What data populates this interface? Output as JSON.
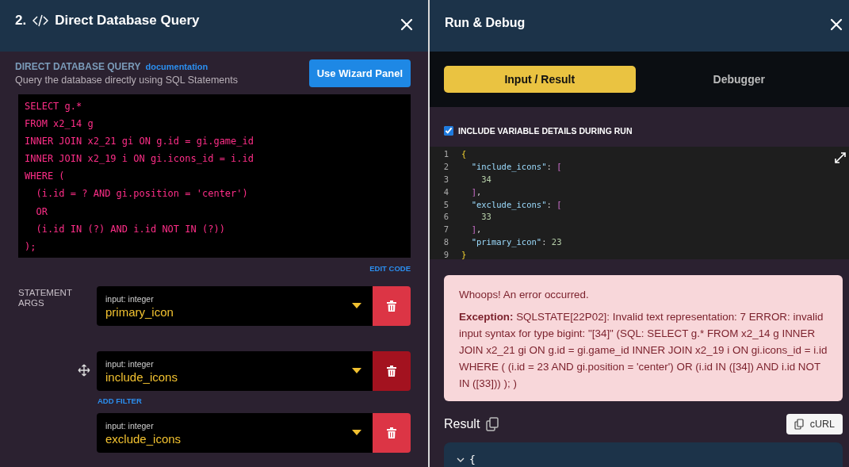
{
  "query_panel": {
    "step": "2.",
    "title": "Direct Database Query",
    "section_title": "DIRECT DATABASE QUERY",
    "doc_link": "documentation",
    "subtitle": "Query the database directly using SQL Statements",
    "wizard_button": "Use Wizard Panel",
    "sql_lines": [
      "SELECT g.*",
      "FROM x2_14 g",
      "INNER JOIN x2_21 gi ON g.id = gi.game_id",
      "INNER JOIN x2_19 i ON gi.icons_id = i.id",
      "WHERE (",
      "  (i.id = ? AND gi.position = 'center')",
      "  OR",
      "  (i.id IN (?) AND i.id NOT IN (?))",
      ");"
    ],
    "edit_code": "EDIT CODE",
    "args_label": "STATEMENT ARGS",
    "args": [
      {
        "type_label": "input: integer",
        "name": "primary_icon",
        "hovered": false
      },
      {
        "type_label": "input: integer",
        "name": "include_icons",
        "hovered": true,
        "add_filter": "ADD FILTER"
      },
      {
        "type_label": "input: integer",
        "name": "exclude_icons",
        "hovered": false
      }
    ]
  },
  "debug_panel": {
    "title": "Run & Debug",
    "tabs": [
      {
        "label": "Input / Result",
        "selected": true
      },
      {
        "label": "Debugger",
        "selected": false
      }
    ],
    "include_details": {
      "label": "INCLUDE VARIABLE DETAILS DURING RUN",
      "checked": true
    },
    "input_lines": [
      [
        {
          "kind": "brace",
          "text": "{"
        }
      ],
      [
        {
          "kind": "key",
          "text": "  \"include_icons\""
        },
        {
          "kind": "punct",
          "text": ": "
        },
        {
          "kind": "bracket",
          "text": "["
        }
      ],
      [
        {
          "kind": "number",
          "text": "    34"
        }
      ],
      [
        {
          "kind": "bracket",
          "text": "  ]"
        },
        {
          "kind": "punct",
          "text": ","
        }
      ],
      [
        {
          "kind": "key",
          "text": "  \"exclude_icons\""
        },
        {
          "kind": "punct",
          "text": ": "
        },
        {
          "kind": "bracket",
          "text": "["
        }
      ],
      [
        {
          "kind": "number",
          "text": "    33"
        }
      ],
      [
        {
          "kind": "bracket",
          "text": "  ]"
        },
        {
          "kind": "punct",
          "text": ","
        }
      ],
      [
        {
          "kind": "key",
          "text": "  \"primary_icon\""
        },
        {
          "kind": "punct",
          "text": ": "
        },
        {
          "kind": "number",
          "text": "23"
        }
      ],
      [
        {
          "kind": "brace",
          "text": "}"
        }
      ]
    ],
    "line_numbers": [
      "1",
      "2",
      "3",
      "4",
      "5",
      "6",
      "7",
      "8",
      "9"
    ],
    "error": {
      "heading": "Whoops! An error occurred.",
      "message": "**Exception:** SQLSTATE[22P02]: Invalid text representation: 7 ERROR: invalid input syntax for type bigint: \"[34]\" (SQL: SELECT g.* FROM x2_14 g INNER JOIN x2_21 gi ON g.id = gi.game_id INNER JOIN x2_19 i ON gi.icons_id = i.id WHERE ( (i.id = 23 AND gi.position = 'center') OR (i.id IN ([34]) AND i.id NOT IN ([33])) ); )"
    },
    "result_title": "Result",
    "curl_button": "cURL",
    "result_lines": [
      "{"
    ]
  }
}
